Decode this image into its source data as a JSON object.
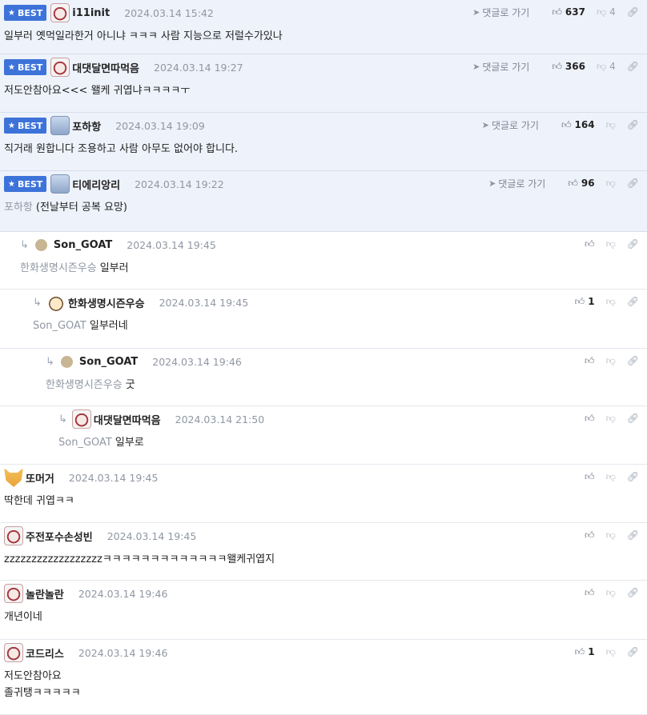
{
  "labels": {
    "best": "BEST",
    "goto": "댓글로 가기"
  },
  "comments": [
    {
      "best": true,
      "author": "i11init",
      "date": "2024.03.14 15:42",
      "text": "일부러 옛먹일라한거 아니냐 ㅋㅋㅋ 사람 지능으로 저럴수가있나",
      "mention": "",
      "up": "637",
      "down": "4",
      "goto": true,
      "avatar": "face-icon"
    },
    {
      "best": true,
      "author": "대댓달면따먹음",
      "date": "2024.03.14 19:27",
      "text": "저도안참아요<<< 왤케 귀엽냐ㅋㅋㅋㅋㅜ",
      "mention": "",
      "up": "366",
      "down": "4",
      "goto": true,
      "avatar": "face-icon"
    },
    {
      "best": true,
      "author": "포하항",
      "date": "2024.03.14 19:09",
      "text": "직거래 원합니다 조용하고 사람 아무도 없어야 합니다.",
      "mention": "",
      "up": "164",
      "down": "",
      "goto": true,
      "avatar": "robot-icon"
    },
    {
      "best": true,
      "author": "티에리앙리",
      "date": "2024.03.14 19:22",
      "text": "(전날부터 공복 요망)",
      "mention": "포하항",
      "up": "96",
      "down": "",
      "goto": true,
      "avatar": "robot-icon"
    },
    {
      "best": false,
      "author": "Son_GOAT",
      "date": "2024.03.14 19:45",
      "text": "일부러",
      "mention": "한화생명시즌우승",
      "up": "",
      "down": "",
      "goto": false,
      "avatar": "dot-icon"
    },
    {
      "best": false,
      "author": "한화생명시즌우승",
      "date": "2024.03.14 19:45",
      "text": "일부러네",
      "mention": "Son_GOAT",
      "up": "1",
      "down": "",
      "goto": false,
      "avatar": "dog-icon"
    },
    {
      "best": false,
      "author": "Son_GOAT",
      "date": "2024.03.14 19:46",
      "text": "굿",
      "mention": "한화생명시즌우승",
      "up": "",
      "down": "",
      "goto": false,
      "avatar": "dot-icon"
    },
    {
      "best": false,
      "author": "대댓달면따먹음",
      "date": "2024.03.14 21:50",
      "text": "일부로",
      "mention": "Son_GOAT",
      "up": "",
      "down": "",
      "goto": false,
      "avatar": "face-icon"
    },
    {
      "best": false,
      "author": "또머거",
      "date": "2024.03.14 19:45",
      "text": "딱한데 귀엽ㅋㅋ",
      "mention": "",
      "up": "",
      "down": "",
      "goto": false,
      "avatar": "fox-icon"
    },
    {
      "best": false,
      "author": "주전포수손성빈",
      "date": "2024.03.14 19:45",
      "text": "zzzzzzzzzzzzzzzzzzㅋㅋㅋㅋㅋㅋㅋㅋㅋㅋㅋㅋㅋ왤케귀엽지",
      "mention": "",
      "up": "",
      "down": "",
      "goto": false,
      "avatar": "face-icon"
    },
    {
      "best": false,
      "author": "놀란놀란",
      "date": "2024.03.14 19:46",
      "text": "개년이네",
      "mention": "",
      "up": "",
      "down": "",
      "goto": false,
      "avatar": "face-icon"
    },
    {
      "best": false,
      "author": "코드리스",
      "date": "2024.03.14 19:46",
      "text": "저도안참아요",
      "text2": "졸귀탱ㅋㅋㅋㅋㅋ",
      "mention": "",
      "up": "1",
      "down": "",
      "goto": false,
      "avatar": "face-icon"
    }
  ]
}
